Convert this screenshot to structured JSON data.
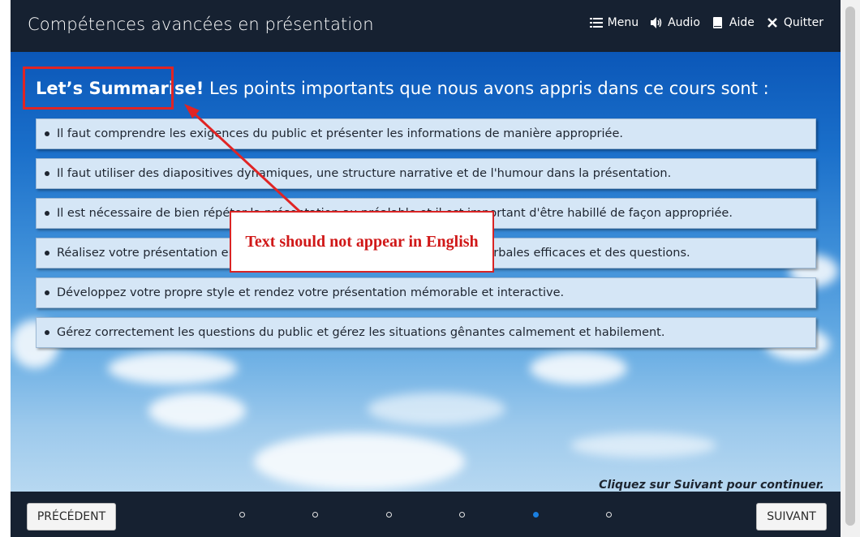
{
  "header": {
    "title": "Compétences avancées en présentation",
    "nav": [
      {
        "label": "Menu",
        "icon": "menu-icon"
      },
      {
        "label": "Audio",
        "icon": "audio-icon"
      },
      {
        "label": "Aide",
        "icon": "help-book-icon"
      },
      {
        "label": "Quitter",
        "icon": "close-icon"
      }
    ]
  },
  "slide": {
    "heading_lead": "Let’s Summarise!",
    "heading_rest": " Les points importants que nous avons appris dans ce cours sont :",
    "items": [
      "Il faut comprendre les exigences du public et présenter les informations de manière appropriée.",
      "Il faut utiliser des diapositives dynamiques, une structure narrative et de l'humour dans la présentation.",
      "Il est nécessaire de bien répéter la présentation au préalable et il est important d'être habillé de façon appropriée.",
      "Réalisez votre présentation en utilisant des techniques verbales et non verbales efficaces et des questions.",
      "Développez votre propre style et rendez votre présentation mémorable et interactive.",
      "Gérez correctement les questions du public et gérez les situations gênantes calmement et habilement."
    ],
    "callout_text": "Text should not appear in English",
    "hint": "Cliquez sur Suivant pour continuer."
  },
  "footer": {
    "prev_label": "PRÉCÉDENT",
    "next_label": "SUIVANT",
    "pages_total": 6,
    "current_page": 5
  },
  "colors": {
    "bar": "#162131",
    "annotation_red": "#e02424",
    "active_dot": "#1a7fe0"
  }
}
